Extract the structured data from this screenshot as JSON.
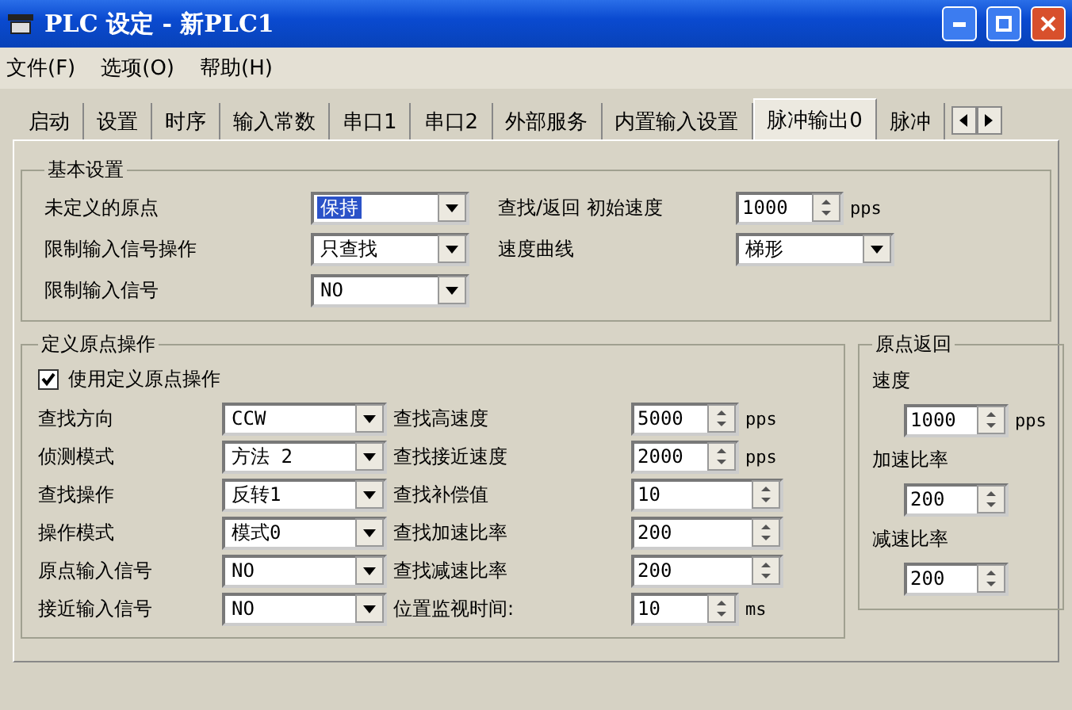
{
  "window": {
    "title": "PLC 设定 - 新PLC1"
  },
  "menu": [
    {
      "label": "文件(F)"
    },
    {
      "label": "选项(O)"
    },
    {
      "label": "帮助(H)"
    }
  ],
  "tabs": [
    {
      "label": "启动",
      "selected": false
    },
    {
      "label": "设置",
      "selected": false
    },
    {
      "label": "时序",
      "selected": false
    },
    {
      "label": "输入常数",
      "selected": false
    },
    {
      "label": "串口1",
      "selected": false
    },
    {
      "label": "串口2",
      "selected": false
    },
    {
      "label": "外部服务",
      "selected": false
    },
    {
      "label": "内置输入设置",
      "selected": false
    },
    {
      "label": "脉冲输出0",
      "selected": true
    },
    {
      "label": "脉冲",
      "selected": false
    }
  ],
  "basic_settings": {
    "title": "基本设置",
    "left": [
      {
        "label": "未定义的原点",
        "value": "保持",
        "focused": true
      },
      {
        "label": "限制输入信号操作",
        "value": "只查找",
        "focused": false
      },
      {
        "label": "限制输入信号",
        "value": "NO",
        "focused": false
      }
    ],
    "right": [
      {
        "kind": "spin",
        "label": "查找/返回 初始速度",
        "value": "1000",
        "unit": "pps"
      },
      {
        "kind": "combo",
        "label": "速度曲线",
        "value": "梯形"
      }
    ]
  },
  "define_origin": {
    "title": "定义原点操作",
    "checkbox": {
      "label": "使用定义原点操作",
      "checked": true
    },
    "rows": [
      {
        "label": "查找方向",
        "value": "CCW",
        "param_label": "查找高速度",
        "param_value": "5000",
        "unit": "pps"
      },
      {
        "label": "侦测模式",
        "value": "方法 2",
        "param_label": "查找接近速度",
        "param_value": "2000",
        "unit": "pps"
      },
      {
        "label": "查找操作",
        "value": "反转1",
        "param_label": "查找补偿值",
        "param_value": "10"
      },
      {
        "label": "操作模式",
        "value": "模式0",
        "param_label": "查找加速比率",
        "param_value": "200"
      },
      {
        "label": "原点输入信号",
        "value": "NO",
        "param_label": "查找减速比率",
        "param_value": "200"
      },
      {
        "label": "接近输入信号",
        "value": "NO",
        "param_label": "位置监视时间:",
        "param_value": "10",
        "unit": "ms"
      }
    ]
  },
  "origin_return": {
    "title": "原点返回",
    "fields": [
      {
        "label": "速度",
        "value": "1000",
        "unit": "pps"
      },
      {
        "label": "加速比率",
        "value": "200"
      },
      {
        "label": "减速比率",
        "value": "200"
      }
    ]
  }
}
